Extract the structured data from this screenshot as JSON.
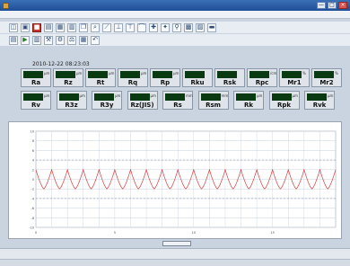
{
  "window": {
    "title": "",
    "icon": "app-icon",
    "controls": [
      "—",
      "□",
      "×"
    ]
  },
  "menubar": {
    "items": []
  },
  "toolbar1": [
    {
      "icon": "open-icon",
      "glyph": "◫"
    },
    {
      "icon": "save-icon",
      "glyph": "▣"
    },
    {
      "icon": "stop-icon",
      "glyph": "■",
      "style": "red"
    },
    {
      "icon": "page-icon",
      "glyph": "▤"
    },
    {
      "icon": "print-icon",
      "glyph": "▦"
    },
    {
      "icon": "preview-icon",
      "glyph": "▥"
    },
    {
      "icon": "copy-icon",
      "glyph": "❐"
    },
    {
      "icon": "zoom-icon",
      "glyph": "⌕"
    },
    {
      "icon": "probe-icon",
      "glyph": "⟋"
    },
    {
      "icon": "measure-icon",
      "glyph": "⊥"
    },
    {
      "icon": "level-icon",
      "glyph": "⊤"
    },
    {
      "icon": "trace-icon",
      "glyph": "⌒"
    },
    {
      "icon": "add-icon",
      "glyph": "✚"
    },
    {
      "icon": "cross-icon",
      "glyph": "✦"
    },
    {
      "icon": "search-icon",
      "glyph": "⚲"
    },
    {
      "icon": "grid-icon",
      "glyph": "▩"
    },
    {
      "icon": "image-icon",
      "glyph": "▨"
    },
    {
      "icon": "display-icon",
      "glyph": "▬"
    }
  ],
  "toolbar2": [
    {
      "icon": "record-icon",
      "glyph": "▤"
    },
    {
      "icon": "play-icon",
      "glyph": "▶",
      "style": "green"
    },
    {
      "icon": "chart-icon",
      "glyph": "▥"
    },
    {
      "icon": "tool-icon",
      "glyph": "⚒"
    },
    {
      "icon": "settings-icon",
      "glyph": "⚙"
    },
    {
      "icon": "calibrate-icon",
      "glyph": "⚖"
    },
    {
      "icon": "filter-icon",
      "glyph": "▦"
    },
    {
      "icon": "undo-icon",
      "glyph": "↶"
    }
  ],
  "timestamp": "2010-12-22 08:23:03",
  "params_row1": [
    {
      "label": "Ra",
      "value": "",
      "unit": "μm"
    },
    {
      "label": "Rz",
      "value": "",
      "unit": "μm"
    },
    {
      "label": "Rt",
      "value": "",
      "unit": "μm"
    },
    {
      "label": "Rq",
      "value": "",
      "unit": "μm"
    },
    {
      "label": "Rp",
      "value": "",
      "unit": "μm"
    },
    {
      "label": "Rku",
      "value": "",
      "unit": ""
    },
    {
      "label": "Rsk",
      "value": "",
      "unit": ""
    },
    {
      "label": "Rpc",
      "value": "",
      "unit": "/cm"
    },
    {
      "label": "Mr1",
      "value": "",
      "unit": "%"
    },
    {
      "label": "Mr2",
      "value": "",
      "unit": "%"
    }
  ],
  "params_row2": [
    {
      "label": "Rv",
      "value": "",
      "unit": "μm"
    },
    {
      "label": "R3z",
      "value": "",
      "unit": "μm"
    },
    {
      "label": "R3y",
      "value": "",
      "unit": "μm"
    },
    {
      "label": "Rz(JIS)",
      "value": "",
      "unit": "μm"
    },
    {
      "label": "Rs",
      "value": "",
      "unit": "mm"
    },
    {
      "label": "Rsm",
      "value": "",
      "unit": "mm"
    },
    {
      "label": "Rk",
      "value": "",
      "unit": "μm"
    },
    {
      "label": "Rpk",
      "value": "",
      "unit": "μm"
    },
    {
      "label": "Rvk",
      "value": "",
      "unit": "μm"
    }
  ],
  "colors": {
    "lcd_bg": "#0a3a12",
    "lcd_text": "#48e25a",
    "curve": "#d43a3a",
    "grid": "#c7d0dc",
    "dashed_guides": "#7a8aa0"
  },
  "chart_data": {
    "type": "line",
    "title": "",
    "xlabel": "",
    "ylabel": "",
    "x": [
      0,
      0.5,
      1,
      1.5,
      2,
      2.5,
      3,
      3.5,
      4,
      4.5,
      5,
      5.5,
      6,
      6.5,
      7,
      7.5,
      8,
      8.5,
      9,
      9.5,
      10,
      10.5,
      11,
      11.5,
      12,
      12.5,
      13,
      13.5,
      14,
      14.5,
      15,
      15.5,
      16,
      16.5,
      17,
      17.5,
      18,
      18.5,
      19
    ],
    "series": [
      {
        "values": [
          2,
          -2,
          2,
          -2,
          2,
          -2,
          2,
          -2,
          2,
          -2,
          2,
          -2,
          2,
          -2,
          2,
          -2,
          2,
          -2,
          2,
          -2,
          2,
          -2,
          2,
          -2,
          2,
          -2,
          2,
          -2,
          2,
          -2,
          2,
          -2,
          2,
          -2,
          2,
          -2,
          2,
          -2,
          2
        ]
      }
    ],
    "ylim": [
      -10,
      10
    ],
    "xlim": [
      0,
      19
    ],
    "grid": true,
    "hint_note": "periodic cusp (scallop) profile, peak ~2, valley ~-2, about 19 cycles"
  },
  "chart_button": {
    "label": ""
  },
  "statusbar": {
    "fields": [],
    "bottom_fields": []
  }
}
